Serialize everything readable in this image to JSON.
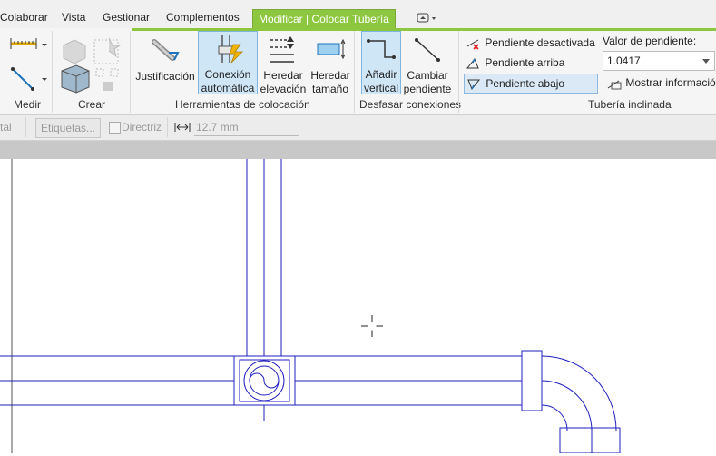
{
  "tabs": [
    {
      "label": "Colaborar",
      "active": false
    },
    {
      "label": "Vista",
      "active": false
    },
    {
      "label": "Gestionar",
      "active": false
    },
    {
      "label": "Complementos",
      "active": false
    },
    {
      "label": "Modificar | Colocar Tubería",
      "active": true
    }
  ],
  "panels": {
    "medir": {
      "label": "Medir"
    },
    "crear": {
      "label": "Crear"
    },
    "colocacion": {
      "label": "Herramientas de colocación",
      "justificacion": "Justificación",
      "conexion_1": "Conexión",
      "conexion_2": "automática",
      "heredar_elev_1": "Heredar",
      "heredar_elev_2": "elevación",
      "heredar_tam_1": "Heredar",
      "heredar_tam_2": "tamaño"
    },
    "desfasar": {
      "label": "Desfasar conexiones",
      "anadir_1": "Añadir",
      "anadir_2": "vertical",
      "cambiar_1": "Cambiar",
      "cambiar_2": "pendiente"
    },
    "inclinada": {
      "label": "Tubería inclinada",
      "pendiente_desactivada": "Pendiente desactivada",
      "pendiente_arriba": "Pendiente arriba",
      "pendiente_abajo": "Pendiente abajo",
      "valor_label": "Valor de pendiente:",
      "valor": "1.0417",
      "mostrar": "Mostrar informació"
    }
  },
  "options_bar": {
    "left_fragment": "tal",
    "etiquetas": "Etiquetas...",
    "directriz": "Directriz",
    "distance": "12.7 mm"
  },
  "colors": {
    "active_tab": "#8dc63f",
    "pipe": "#1f1fbf",
    "selected": "#cfe6f7"
  }
}
